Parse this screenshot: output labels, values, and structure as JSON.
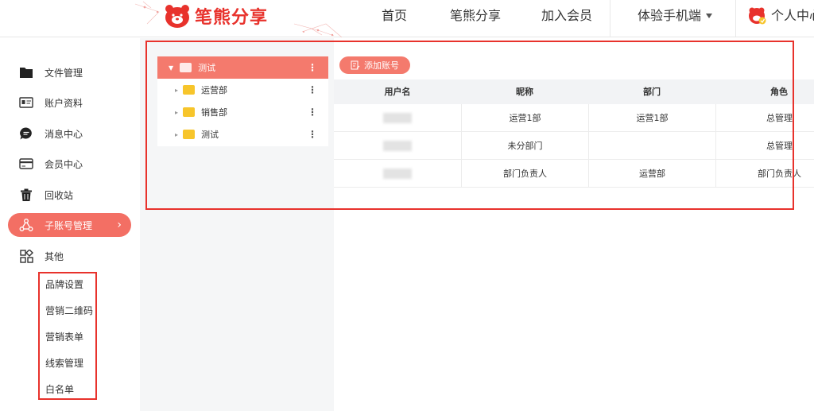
{
  "header": {
    "logo_text": "笔熊分享",
    "nav": {
      "home": "首页",
      "share": "笔熊分享",
      "join": "加入会员",
      "mobile": "体验手机端",
      "personal": "个人中心"
    }
  },
  "sidebar": {
    "items": [
      {
        "label": "文件管理",
        "icon": "folder-icon"
      },
      {
        "label": "账户资料",
        "icon": "id-card-icon"
      },
      {
        "label": "消息中心",
        "icon": "chat-bubble-icon"
      },
      {
        "label": "会员中心",
        "icon": "credit-card-icon"
      },
      {
        "label": "回收站",
        "icon": "trash-icon"
      },
      {
        "label": "子账号管理",
        "icon": "network-icon"
      },
      {
        "label": "其他",
        "icon": "grid-icon"
      }
    ],
    "sub_items": [
      "品牌设置",
      "营销二维码",
      "营销表单",
      "线索管理",
      "白名单"
    ]
  },
  "tree": {
    "root": "测试",
    "children": [
      "运营部",
      "销售部",
      "测试"
    ]
  },
  "table": {
    "add_button": "添加账号",
    "columns": [
      "用户名",
      "昵称",
      "部门",
      "角色"
    ],
    "rows": [
      {
        "nickname": "运营1部",
        "department": "运营1部",
        "role": "总管理"
      },
      {
        "nickname": "未分部门",
        "department": "",
        "role": "总管理"
      },
      {
        "nickname": "部门负责人",
        "department": "运营部",
        "role": "部门负责人"
      }
    ]
  },
  "colors": {
    "brand": "#e8322c",
    "accent": "#f47a6d",
    "folder": "#f7c52b"
  }
}
